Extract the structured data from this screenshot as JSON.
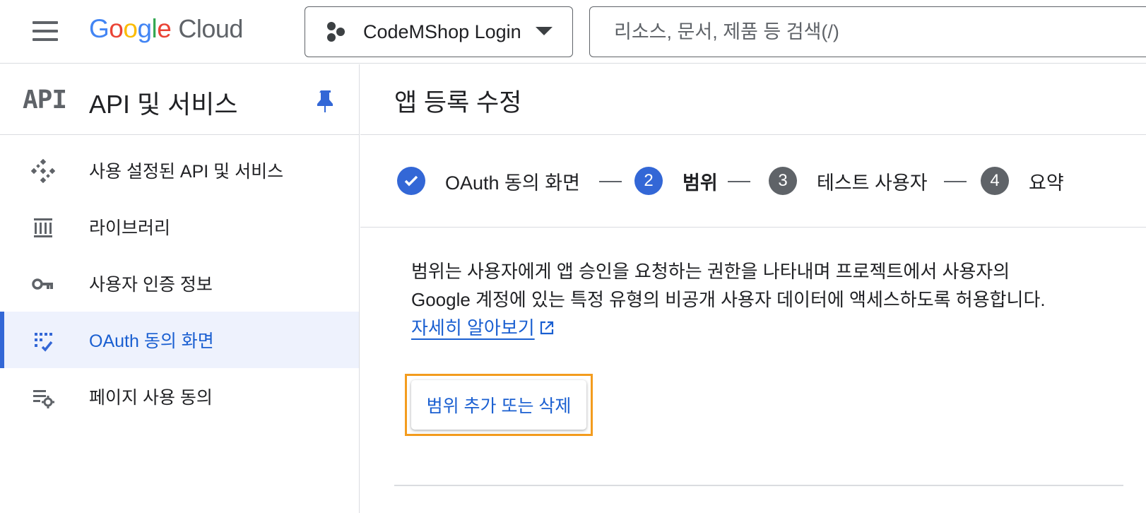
{
  "topbar": {
    "menu_icon": "hamburger-menu-icon",
    "logo": {
      "google": "Google",
      "cloud": "Cloud"
    },
    "project": {
      "icon": "project-hexagons-icon",
      "name": "CodeMShop Login",
      "dropdown_icon": "caret-down-icon"
    },
    "search": {
      "placeholder": "리소스, 문서, 제품 등 검색(/)",
      "value": ""
    }
  },
  "sidebar": {
    "logo_text": "API",
    "title": "API 및 서비스",
    "pin_icon": "pin-icon",
    "items": [
      {
        "label": "사용 설정된 API 및 서비스",
        "icon": "api-diamond-icon",
        "active": false
      },
      {
        "label": "라이브러리",
        "icon": "library-icon",
        "active": false
      },
      {
        "label": "사용자 인증 정보",
        "icon": "key-icon",
        "active": false
      },
      {
        "label": "OAuth 동의 화면",
        "icon": "oauth-consent-icon",
        "active": true
      },
      {
        "label": "페이지 사용 동의",
        "icon": "page-settings-icon",
        "active": false
      }
    ]
  },
  "main": {
    "title": "앱 등록 수정",
    "steps": [
      {
        "label": "OAuth 동의 화면",
        "state": "done",
        "number": ""
      },
      {
        "label": "범위",
        "state": "current",
        "number": "2"
      },
      {
        "label": "테스트 사용자",
        "state": "todo",
        "number": "3"
      },
      {
        "label": "요약",
        "state": "todo",
        "number": "4"
      }
    ],
    "description_line1": "범위는 사용자에게 앱 승인을 요청하는 권한을 나타내며 프로젝트에서 사용자의",
    "description_line2": "Google 계정에 있는 특정 유형의 비공개 사용자 데이터에 액세스하도록 허용합니다.",
    "learn_more": "자세히 알아보기",
    "learn_more_icon": "external-link-icon",
    "add_remove_scopes_button": "범위 추가 또는 삭제"
  },
  "colors": {
    "accent": "#1a5fd1",
    "step_active": "#3367d6",
    "step_inactive": "#5f6368",
    "highlight_frame": "#f39c1e",
    "nav_active_bg": "#eef2fd"
  }
}
